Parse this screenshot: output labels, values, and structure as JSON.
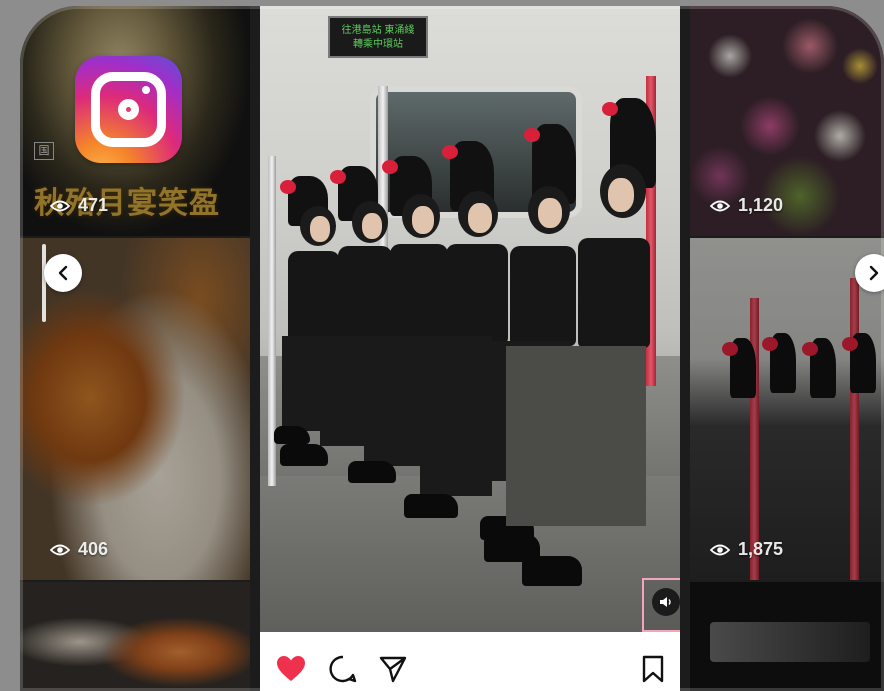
{
  "app": {
    "logo_icon": "instagram-logo-icon"
  },
  "grid": {
    "tiles": [
      {
        "views": "471",
        "caption": "秋殆月宴笑盈"
      },
      {
        "views": "406"
      },
      {
        "views": "1,120"
      },
      {
        "views": "1,875"
      }
    ]
  },
  "post": {
    "video": {
      "sign_line1": "往港島站 東涌綫",
      "sign_line2": "轉乘中環站"
    },
    "sound_icon": "speaker-icon",
    "actions": {
      "like_icon": "heart-filled-icon",
      "comment_icon": "comment-icon",
      "share_icon": "send-icon",
      "save_icon": "bookmark-icon"
    }
  },
  "navigation": {
    "prev_icon": "chevron-left-icon",
    "next_icon": "chevron-right-icon"
  },
  "colors": {
    "like": "#f0314d",
    "sound_border": "#f2a6be",
    "gold_text": "#c9a13e"
  }
}
